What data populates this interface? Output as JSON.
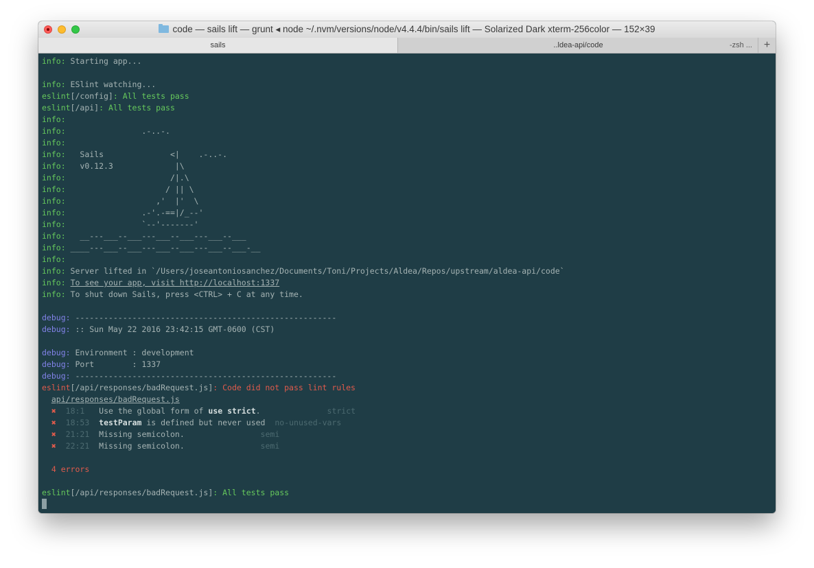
{
  "window": {
    "title": "code — sails lift — grunt ◂ node ~/.nvm/versions/node/v4.4.4/bin/sails lift — Solarized Dark xterm-256color — 152×39",
    "folder_icon": "folder-icon"
  },
  "tabs": {
    "active": "sails",
    "second": "..ldea-api/code",
    "second_sub": "-zsh ...",
    "new_tab": "+"
  },
  "colors": {
    "background": "#1f3d46",
    "info_prefix": "#66c85c",
    "debug_prefix": "#8282e8",
    "error": "#e15b4c",
    "text": "#a5b3b3"
  },
  "terminal": {
    "l1": {
      "p": "info:",
      "t": " Starting app..."
    },
    "l3": {
      "p": "info:",
      "t": " ESlint watching..."
    },
    "l4": {
      "a": "eslint",
      "b": "[/config]",
      "c": ": All tests pass"
    },
    "l5": {
      "a": "eslint",
      "b": "[/api]",
      "c": ": All tests pass"
    },
    "ascii": [
      {
        "p": "info:",
        "t": ""
      },
      {
        "p": "info:",
        "t": "                .-..-."
      },
      {
        "p": "info:",
        "t": ""
      },
      {
        "p": "info:",
        "t": "   Sails              <|    .-..-."
      },
      {
        "p": "info:",
        "t": "   v0.12.3             |\\"
      },
      {
        "p": "info:",
        "t": "                      /|.\\"
      },
      {
        "p": "info:",
        "t": "                     / || \\"
      },
      {
        "p": "info:",
        "t": "                   ,'  |'  \\"
      },
      {
        "p": "info:",
        "t": "                .-'.-==|/_--'"
      },
      {
        "p": "info:",
        "t": "                `--'-------'"
      },
      {
        "p": "info:",
        "t": "   __---___--___---___--___---___--___"
      },
      {
        "p": "info:",
        "t": " ____---___--___---___--___---___--___-__"
      },
      {
        "p": "info:",
        "t": ""
      }
    ],
    "server": {
      "p": "info:",
      "t": " Server lifted in `/Users/joseantoniosanchez/Documents/Toni/Projects/Aldea/Repos/upstream/aldea-api/code`"
    },
    "visit": {
      "p": "info:",
      "t": "To see your app, visit http://localhost:1337"
    },
    "shutdown": {
      "p": "info:",
      "t": " To shut down Sails, press <CTRL> + C at any time."
    },
    "debug1": {
      "p": "debug:",
      "t": " -------------------------------------------------------"
    },
    "debug2": {
      "p": "debug:",
      "t": " :: Sun May 22 2016 23:42:15 GMT-0600 (CST)"
    },
    "debug3": {
      "p": "debug:",
      "t": " Environment : development"
    },
    "debug4": {
      "p": "debug:",
      "t": " Port        : 1337"
    },
    "debug5": {
      "p": "debug:",
      "t": " -------------------------------------------------------"
    },
    "lint_fail": {
      "a": "eslint",
      "b": "[/api/responses/badRequest.js]",
      "c": ": Code did not pass lint rules"
    },
    "lint_file": "api/responses/badRequest.js",
    "errors": [
      {
        "mark": "✖",
        "loc": "18:1 ",
        "pre": "Use the global form of ",
        "bold": "use strict",
        "post": ".  ",
        "rule": "strict"
      },
      {
        "mark": "✖",
        "loc": "18:53",
        "pre": "",
        "bold": "testParam",
        "post": " is defined but never used",
        "rule": "no-unused-vars"
      },
      {
        "mark": "✖",
        "loc": "21:21",
        "pre": "Missing semicolon.",
        "bold": "",
        "post": "",
        "rule": "semi"
      },
      {
        "mark": "✖",
        "loc": "22:21",
        "pre": "Missing semicolon.",
        "bold": "",
        "post": "",
        "rule": "semi"
      }
    ],
    "error_count": "4 errors",
    "lint_pass": {
      "a": "eslint",
      "b": "[/api/responses/badRequest.js]",
      "c": ": All tests pass"
    }
  }
}
